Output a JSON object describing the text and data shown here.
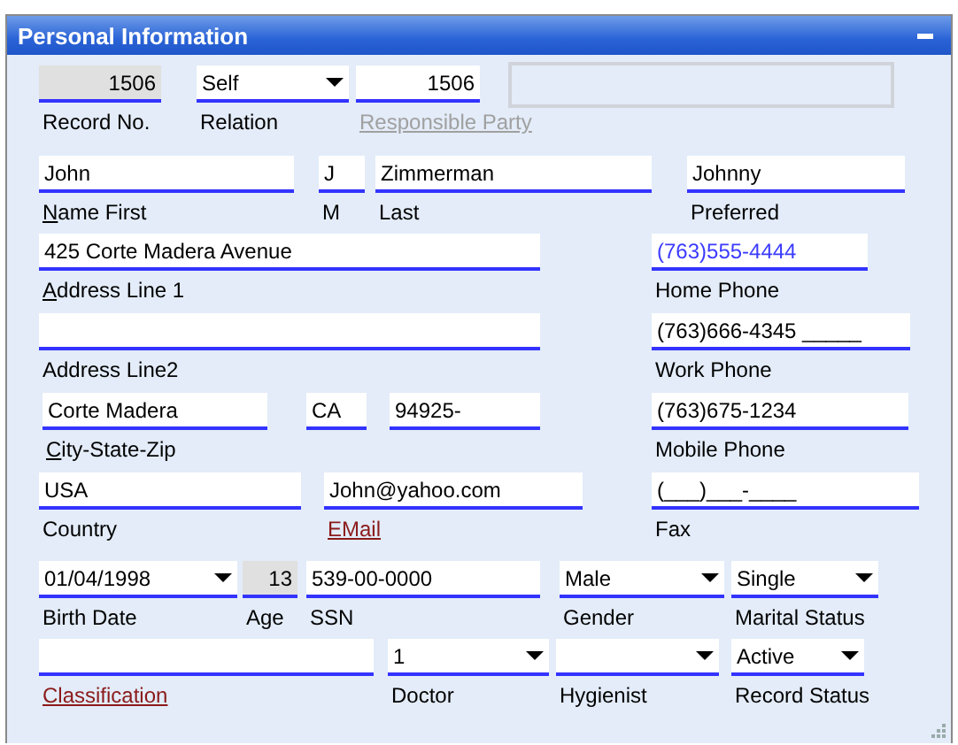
{
  "panel": {
    "title": "Personal Information"
  },
  "rows": [
    {
      "fields": [
        {
          "kind": "readonly",
          "value": "1506",
          "label": {
            "text": "Record No.",
            "kind": "plain"
          }
        },
        {
          "kind": "dropdown",
          "value": "Self",
          "label": {
            "text": "Relation",
            "kind": "plain"
          }
        },
        {
          "kind": "number",
          "value": "1506",
          "label": {
            "text": "Responsible Party",
            "kind": "disabled"
          }
        },
        {
          "kind": "box"
        }
      ]
    },
    {
      "fields": [
        {
          "kind": "text",
          "value": "John",
          "label": {
            "text": "Name First",
            "kind": "access_key"
          }
        },
        {
          "kind": "text",
          "value": "J",
          "label": {
            "text": "M",
            "kind": "plain"
          }
        },
        {
          "kind": "text",
          "value": "Zimmerman",
          "label": {
            "text": "Last",
            "kind": "plain"
          }
        },
        {
          "kind": "text",
          "value": "Johnny",
          "label": {
            "text": "Preferred",
            "kind": "plain"
          }
        }
      ]
    },
    {
      "fields": [
        {
          "kind": "text",
          "value": "425 Corte Madera Avenue",
          "label": {
            "text": "Address Line 1",
            "kind": "access_key"
          }
        },
        {
          "kind": "link_text",
          "value": "(763)555-4444",
          "label": {
            "text": "Home Phone",
            "kind": "plain"
          }
        }
      ]
    },
    {
      "fields": [
        {
          "kind": "text",
          "label": {
            "text": "Address Line2",
            "kind": "plain"
          }
        },
        {
          "kind": "text",
          "value": "(763)666-4345 _____",
          "label": {
            "text": "Work Phone",
            "kind": "plain"
          }
        }
      ]
    },
    {
      "fields": [
        {
          "kind": "text",
          "value": "Corte Madera",
          "label": {
            "text": "City-State-Zip",
            "kind": "access_key"
          }
        },
        {
          "kind": "text",
          "value": "CA"
        },
        {
          "kind": "text",
          "value": "94925-"
        },
        {
          "kind": "text",
          "value": "(763)675-1234",
          "label": {
            "text": "Mobile Phone",
            "kind": "plain"
          }
        }
      ]
    },
    {
      "fields": [
        {
          "kind": "text",
          "value": "USA",
          "label": {
            "text": "Country",
            "kind": "plain"
          }
        },
        {
          "kind": "text",
          "value": "John@yahoo.com",
          "label": {
            "text": "EMail",
            "kind": "link"
          }
        },
        {
          "kind": "text",
          "value": "(___)___-____",
          "label": {
            "text": "Fax",
            "kind": "plain"
          }
        }
      ]
    },
    {
      "fields": [
        {
          "kind": "dropdown",
          "value": "01/04/1998",
          "label": {
            "text": "Birth Date",
            "kind": "plain"
          }
        },
        {
          "kind": "readonly",
          "value": "13",
          "label": {
            "text": "Age",
            "kind": "plain"
          }
        },
        {
          "kind": "text",
          "value": "539-00-0000",
          "label": {
            "text": "SSN",
            "kind": "plain"
          }
        },
        {
          "kind": "dropdown",
          "value": "Male",
          "label": {
            "text": "Gender",
            "kind": "plain"
          }
        },
        {
          "kind": "dropdown",
          "value": "Single",
          "label": {
            "text": "Marital Status",
            "kind": "plain"
          }
        }
      ]
    },
    {
      "fields": [
        {
          "kind": "text",
          "label": {
            "text": "Classification",
            "kind": "link"
          }
        },
        {
          "kind": "dropdown",
          "value": "1",
          "label": {
            "text": "Doctor",
            "kind": "plain"
          }
        },
        {
          "kind": "dropdown",
          "label": {
            "text": "Hygienist",
            "kind": "plain"
          }
        },
        {
          "kind": "dropdown",
          "value": "Active",
          "label": {
            "text": "Record Status",
            "kind": "plain"
          }
        }
      ]
    }
  ]
}
